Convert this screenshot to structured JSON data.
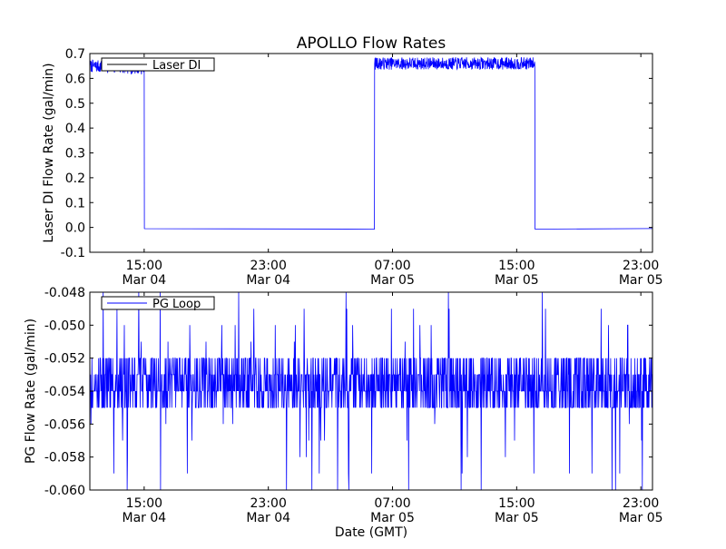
{
  "figure": {
    "title": "APOLLO Flow Rates",
    "xlabel": "Date (GMT)"
  },
  "colors": {
    "series": "#0000ff",
    "axes": "#000000",
    "background": "#ffffff"
  },
  "chart_data": [
    {
      "type": "line",
      "name": "top",
      "title": "APOLLO Flow Rates",
      "ylabel": "Laser DI Flow Rate (gal/min)",
      "xlabel": "",
      "xlim": [
        "Mar 04 11:30",
        "Mar 05 23:45"
      ],
      "ylim": [
        -0.1,
        0.7
      ],
      "yticks": [
        "-0.1",
        "0.0",
        "0.1",
        "0.2",
        "0.3",
        "0.4",
        "0.5",
        "0.6",
        "0.7"
      ],
      "xticks": [
        {
          "time": "15:00",
          "date": "Mar 04"
        },
        {
          "time": "23:00",
          "date": "Mar 04"
        },
        {
          "time": "07:00",
          "date": "Mar 05"
        },
        {
          "time": "15:00",
          "date": "Mar 05"
        },
        {
          "time": "23:00",
          "date": "Mar 05"
        }
      ],
      "legend": {
        "label": "Laser DI",
        "placement": "upper-left"
      },
      "grid": false,
      "series": [
        {
          "name": "Laser DI",
          "x": [
            "Mar 04 11:30",
            "Mar 04 15:00",
            "Mar 04 15:01",
            "Mar 05 05:50",
            "Mar 05 05:51",
            "Mar 05 16:10",
            "Mar 05 16:11",
            "Mar 05 23:45"
          ],
          "y": [
            0.65,
            0.64,
            -0.005,
            -0.005,
            0.66,
            0.66,
            -0.005,
            -0.005
          ]
        }
      ]
    },
    {
      "type": "line",
      "name": "bottom",
      "title": "",
      "ylabel": "PG Flow Rate (gal/min)",
      "xlabel": "Date (GMT)",
      "xlim": [
        "Mar 04 11:30",
        "Mar 05 23:45"
      ],
      "ylim": [
        -0.06,
        -0.048
      ],
      "yticks": [
        "-0.060",
        "-0.058",
        "-0.056",
        "-0.054",
        "-0.052",
        "-0.050",
        "-0.048"
      ],
      "xticks": [
        {
          "time": "15:00",
          "date": "Mar 04"
        },
        {
          "time": "23:00",
          "date": "Mar 04"
        },
        {
          "time": "07:00",
          "date": "Mar 05"
        },
        {
          "time": "15:00",
          "date": "Mar 05"
        },
        {
          "time": "23:00",
          "date": "Mar 05"
        }
      ],
      "legend": {
        "label": "PG Loop",
        "placement": "upper-left"
      },
      "grid": false,
      "series": [
        {
          "name": "PG Loop",
          "levels": [
            -0.06,
            -0.059,
            -0.058,
            -0.057,
            -0.056,
            -0.055,
            -0.054,
            -0.053,
            -0.052,
            -0.051,
            -0.05,
            -0.049,
            -0.048
          ],
          "mean": -0.0535,
          "y_min": -0.06,
          "y_max": -0.048
        }
      ]
    }
  ]
}
